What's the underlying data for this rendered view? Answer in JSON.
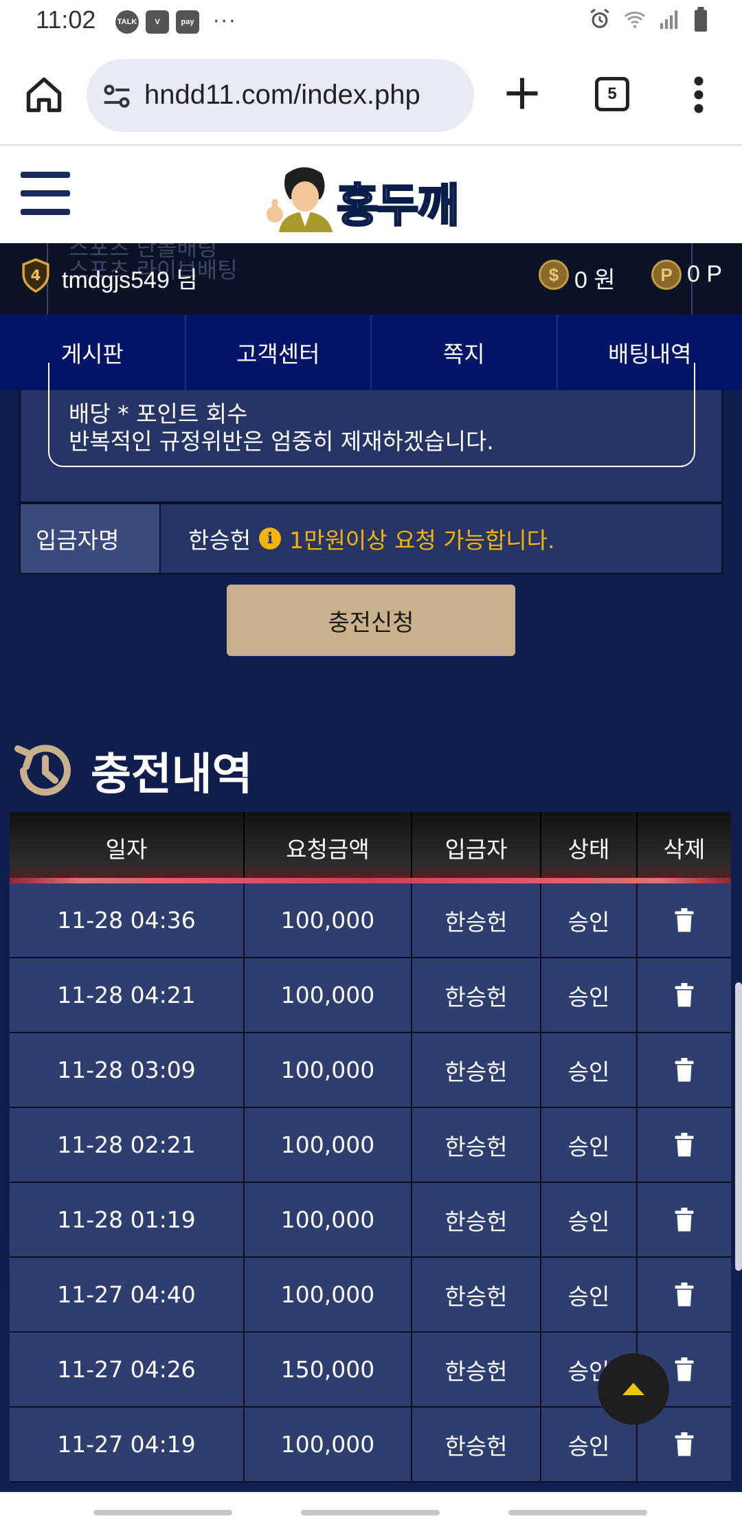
{
  "status_bar": {
    "time": "11:02",
    "notifications": [
      "TALK",
      "V",
      "pay"
    ],
    "more": "···"
  },
  "browser": {
    "url": "hndd11.com/index.php",
    "tab_count": "5"
  },
  "site": {
    "logo_text": "홍두깨"
  },
  "user_bar": {
    "rank": "4",
    "username": "tmdgjs549 님",
    "money": "0 원",
    "points": "0 P",
    "money_icon": "$",
    "points_icon": "P",
    "ghost_lines": [
      "스포츠 단폴배팅",
      "스포츠 라이브배팅"
    ]
  },
  "nav_tabs": [
    "게시판",
    "고객센터",
    "쪽지",
    "배팅내역"
  ],
  "notice": {
    "lines": [
      "배당 * 포인트 회수",
      "반복적인 규정위반은 엄중히 제재하겠습니다."
    ]
  },
  "depositor": {
    "label": "입금자명",
    "name": "한승헌",
    "hint": "1만원이상 요청 가능합니다."
  },
  "charge_button": "충전신청",
  "history": {
    "title": "충전내역",
    "columns": [
      "일자",
      "요청금액",
      "입금자",
      "상태",
      "삭제"
    ],
    "rows": [
      {
        "date": "11-28 04:36",
        "amount": "100,000",
        "depositor": "한승헌",
        "status": "승인"
      },
      {
        "date": "11-28 04:21",
        "amount": "100,000",
        "depositor": "한승헌",
        "status": "승인"
      },
      {
        "date": "11-28 03:09",
        "amount": "100,000",
        "depositor": "한승헌",
        "status": "승인"
      },
      {
        "date": "11-28 02:21",
        "amount": "100,000",
        "depositor": "한승헌",
        "status": "승인"
      },
      {
        "date": "11-28 01:19",
        "amount": "100,000",
        "depositor": "한승헌",
        "status": "승인"
      },
      {
        "date": "11-27 04:40",
        "amount": "100,000",
        "depositor": "한승헌",
        "status": "승인"
      },
      {
        "date": "11-27 04:26",
        "amount": "150,000",
        "depositor": "한승헌",
        "status": "승인"
      },
      {
        "date": "11-27 04:19",
        "amount": "100,000",
        "depositor": "한승헌",
        "status": "승인"
      }
    ]
  },
  "colors": {
    "accent_gold": "#f5b400",
    "button_tan": "#c8b08c",
    "nav_blue": "#041466",
    "row_blue": "#2e3e6e"
  },
  "icons": {
    "home": "home-icon",
    "site_info": "tune-icon",
    "new_tab": "plus-icon",
    "tabs": "tabs-icon",
    "menu": "more-vert-icon",
    "hamburger": "hamburger-icon",
    "rank": "shield-icon",
    "history": "history-icon",
    "delete": "trash-icon",
    "scroll_top": "chevron-up-icon"
  }
}
